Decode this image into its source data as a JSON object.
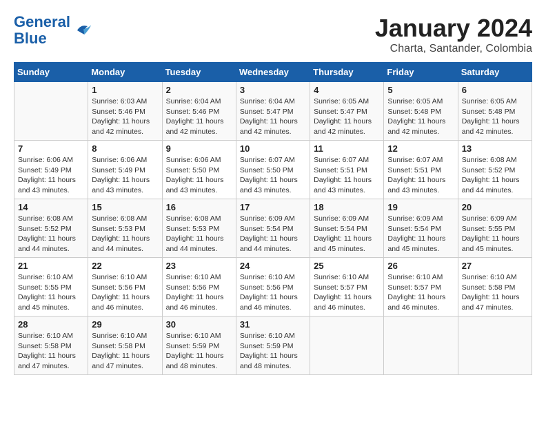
{
  "header": {
    "logo_line1": "General",
    "logo_line2": "Blue",
    "title": "January 2024",
    "subtitle": "Charta, Santander, Colombia"
  },
  "days_of_week": [
    "Sunday",
    "Monday",
    "Tuesday",
    "Wednesday",
    "Thursday",
    "Friday",
    "Saturday"
  ],
  "weeks": [
    [
      {
        "day": "",
        "info": ""
      },
      {
        "day": "1",
        "info": "Sunrise: 6:03 AM\nSunset: 5:46 PM\nDaylight: 11 hours\nand 42 minutes."
      },
      {
        "day": "2",
        "info": "Sunrise: 6:04 AM\nSunset: 5:46 PM\nDaylight: 11 hours\nand 42 minutes."
      },
      {
        "day": "3",
        "info": "Sunrise: 6:04 AM\nSunset: 5:47 PM\nDaylight: 11 hours\nand 42 minutes."
      },
      {
        "day": "4",
        "info": "Sunrise: 6:05 AM\nSunset: 5:47 PM\nDaylight: 11 hours\nand 42 minutes."
      },
      {
        "day": "5",
        "info": "Sunrise: 6:05 AM\nSunset: 5:48 PM\nDaylight: 11 hours\nand 42 minutes."
      },
      {
        "day": "6",
        "info": "Sunrise: 6:05 AM\nSunset: 5:48 PM\nDaylight: 11 hours\nand 42 minutes."
      }
    ],
    [
      {
        "day": "7",
        "info": "Sunrise: 6:06 AM\nSunset: 5:49 PM\nDaylight: 11 hours\nand 43 minutes."
      },
      {
        "day": "8",
        "info": "Sunrise: 6:06 AM\nSunset: 5:49 PM\nDaylight: 11 hours\nand 43 minutes."
      },
      {
        "day": "9",
        "info": "Sunrise: 6:06 AM\nSunset: 5:50 PM\nDaylight: 11 hours\nand 43 minutes."
      },
      {
        "day": "10",
        "info": "Sunrise: 6:07 AM\nSunset: 5:50 PM\nDaylight: 11 hours\nand 43 minutes."
      },
      {
        "day": "11",
        "info": "Sunrise: 6:07 AM\nSunset: 5:51 PM\nDaylight: 11 hours\nand 43 minutes."
      },
      {
        "day": "12",
        "info": "Sunrise: 6:07 AM\nSunset: 5:51 PM\nDaylight: 11 hours\nand 43 minutes."
      },
      {
        "day": "13",
        "info": "Sunrise: 6:08 AM\nSunset: 5:52 PM\nDaylight: 11 hours\nand 44 minutes."
      }
    ],
    [
      {
        "day": "14",
        "info": "Sunrise: 6:08 AM\nSunset: 5:52 PM\nDaylight: 11 hours\nand 44 minutes."
      },
      {
        "day": "15",
        "info": "Sunrise: 6:08 AM\nSunset: 5:53 PM\nDaylight: 11 hours\nand 44 minutes."
      },
      {
        "day": "16",
        "info": "Sunrise: 6:08 AM\nSunset: 5:53 PM\nDaylight: 11 hours\nand 44 minutes."
      },
      {
        "day": "17",
        "info": "Sunrise: 6:09 AM\nSunset: 5:54 PM\nDaylight: 11 hours\nand 44 minutes."
      },
      {
        "day": "18",
        "info": "Sunrise: 6:09 AM\nSunset: 5:54 PM\nDaylight: 11 hours\nand 45 minutes."
      },
      {
        "day": "19",
        "info": "Sunrise: 6:09 AM\nSunset: 5:54 PM\nDaylight: 11 hours\nand 45 minutes."
      },
      {
        "day": "20",
        "info": "Sunrise: 6:09 AM\nSunset: 5:55 PM\nDaylight: 11 hours\nand 45 minutes."
      }
    ],
    [
      {
        "day": "21",
        "info": "Sunrise: 6:10 AM\nSunset: 5:55 PM\nDaylight: 11 hours\nand 45 minutes."
      },
      {
        "day": "22",
        "info": "Sunrise: 6:10 AM\nSunset: 5:56 PM\nDaylight: 11 hours\nand 46 minutes."
      },
      {
        "day": "23",
        "info": "Sunrise: 6:10 AM\nSunset: 5:56 PM\nDaylight: 11 hours\nand 46 minutes."
      },
      {
        "day": "24",
        "info": "Sunrise: 6:10 AM\nSunset: 5:56 PM\nDaylight: 11 hours\nand 46 minutes."
      },
      {
        "day": "25",
        "info": "Sunrise: 6:10 AM\nSunset: 5:57 PM\nDaylight: 11 hours\nand 46 minutes."
      },
      {
        "day": "26",
        "info": "Sunrise: 6:10 AM\nSunset: 5:57 PM\nDaylight: 11 hours\nand 46 minutes."
      },
      {
        "day": "27",
        "info": "Sunrise: 6:10 AM\nSunset: 5:58 PM\nDaylight: 11 hours\nand 47 minutes."
      }
    ],
    [
      {
        "day": "28",
        "info": "Sunrise: 6:10 AM\nSunset: 5:58 PM\nDaylight: 11 hours\nand 47 minutes."
      },
      {
        "day": "29",
        "info": "Sunrise: 6:10 AM\nSunset: 5:58 PM\nDaylight: 11 hours\nand 47 minutes."
      },
      {
        "day": "30",
        "info": "Sunrise: 6:10 AM\nSunset: 5:59 PM\nDaylight: 11 hours\nand 48 minutes."
      },
      {
        "day": "31",
        "info": "Sunrise: 6:10 AM\nSunset: 5:59 PM\nDaylight: 11 hours\nand 48 minutes."
      },
      {
        "day": "",
        "info": ""
      },
      {
        "day": "",
        "info": ""
      },
      {
        "day": "",
        "info": ""
      }
    ]
  ]
}
